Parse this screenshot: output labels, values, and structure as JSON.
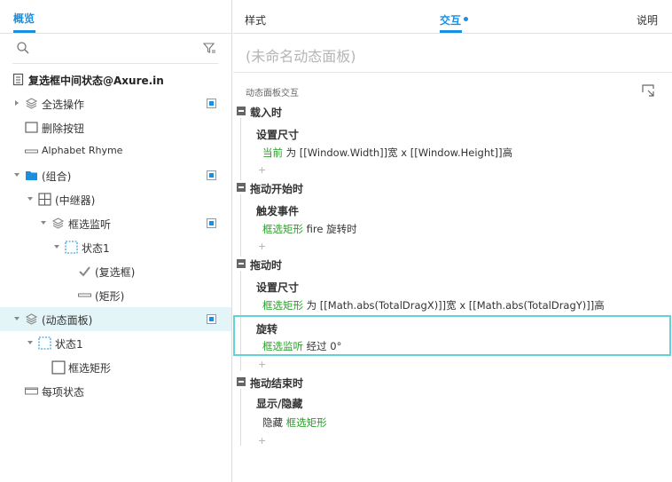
{
  "left_panel": {
    "tab": "概览",
    "search": {
      "placeholder": ""
    },
    "tree": [
      {
        "label": "复选框中间状态@Axure.in",
        "icon": "page-icon",
        "bold": true
      },
      {
        "label": "全选操作",
        "icon": "layers-icon",
        "caret": "right",
        "badge": true
      },
      {
        "label": "删除按钮",
        "icon": "box-icon"
      },
      {
        "label": "Alphabet Rhyme",
        "icon": "line-shape-icon"
      },
      {
        "label": "(组合)",
        "icon": "folder-icon",
        "caret": "down",
        "badge": true
      },
      {
        "label": "(中继器)",
        "icon": "grid-icon",
        "caret": "down"
      },
      {
        "label": "框选监听",
        "icon": "layers-icon",
        "caret": "down",
        "badge": true
      },
      {
        "label": "状态1",
        "icon": "state-dashed-icon",
        "caret": "down"
      },
      {
        "label": "(复选框)",
        "icon": "checkmark-icon"
      },
      {
        "label": "(矩形)",
        "icon": "line-shape-icon"
      },
      {
        "label": "(动态面板)",
        "icon": "layers-icon",
        "caret": "down",
        "badge": true,
        "selected": true
      },
      {
        "label": "状态1",
        "icon": "state-dashed-icon",
        "caret": "down"
      },
      {
        "label": "框选矩形",
        "icon": "box-icon"
      },
      {
        "label": "每项状态",
        "icon": "line-shape-icon"
      }
    ]
  },
  "right_panel": {
    "tabs": {
      "style": "样式",
      "interaction": "交互",
      "notes": "说明"
    },
    "panel_name": "(未命名动态面板)",
    "section_label": "动态面板交互",
    "events": {
      "load": {
        "title": "载入时",
        "action_title": "设置尺寸",
        "target": "当前",
        "detail": " 为 [[Window.Width]]宽 x [[Window.Height]]高"
      },
      "drag_start": {
        "title": "拖动开始时",
        "action_title": "触发事件",
        "target": "框选矩形",
        "detail": " fire 旋转时"
      },
      "drag": {
        "title": "拖动时",
        "action1_title": "设置尺寸",
        "action1_target": "框选矩形",
        "action1_detail": " 为 [[Math.abs(TotalDragX)]]宽 x [[Math.abs(TotalDragY)]]高",
        "action2_title": "旋转",
        "action2_target": "框选监听",
        "action2_detail": " 经过 0°"
      },
      "drag_end": {
        "title": "拖动结束时",
        "action_title": "显示/隐藏",
        "prefix": "隐藏 ",
        "target": "框选矩形"
      }
    },
    "plus_symbol": "+"
  },
  "colors": {
    "accent": "#1a8fe0",
    "target_green": "#2aa12a",
    "selection_border": "#5fd3d8",
    "selected_row": "#e3f5f6"
  }
}
